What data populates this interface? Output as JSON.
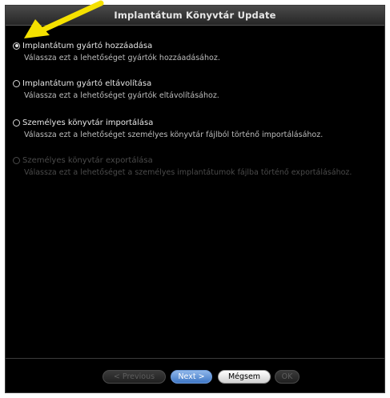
{
  "window": {
    "title": "Implantátum Könyvtár Update"
  },
  "options": [
    {
      "label": "Implantátum gyártó hozzáadása",
      "description": "Válassza ezt a lehetőséget gyártók hozzáadásához.",
      "selected": true,
      "enabled": true
    },
    {
      "label": "Implantátum gyártó eltávolítása",
      "description": "Válassza ezt a lehetőséget gyártók eltávolításához.",
      "selected": false,
      "enabled": true
    },
    {
      "label": "Személyes könyvtár importálása",
      "description": "Válassza ezt a lehetőséget személyes könyvtár fájlból történő importálásához.",
      "selected": false,
      "enabled": true
    },
    {
      "label": "Személyes könyvtár exportálása",
      "description": "Válassza ezt a lehetőséget a személyes implantátumok fájlba történő exportálásához.",
      "selected": false,
      "enabled": false
    }
  ],
  "buttons": {
    "previous": "< Previous",
    "next": "Next >",
    "cancel": "Mégsem",
    "ok": "OK"
  },
  "annotation": {
    "arrow_color": "#f5e100",
    "arrow_icon": "pointer-arrow-icon"
  },
  "colors": {
    "background": "#000000",
    "next_button": "#4f86d1",
    "titlebar": "#2e2e2e"
  }
}
